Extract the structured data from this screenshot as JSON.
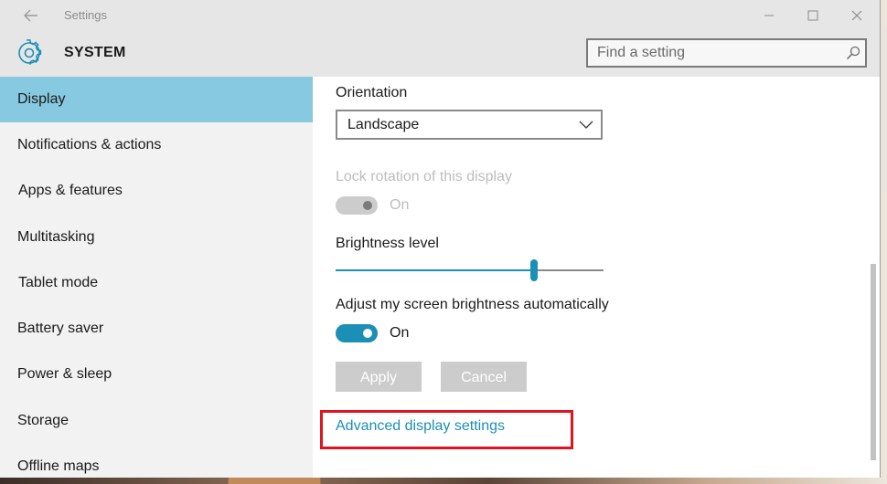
{
  "window": {
    "title": "Settings",
    "section_title": "SYSTEM"
  },
  "search": {
    "placeholder": "Find a setting"
  },
  "sidebar": {
    "items": [
      {
        "label": "Display",
        "selected": true
      },
      {
        "label": "Notifications & actions",
        "selected": false
      },
      {
        "label": "Apps & features",
        "selected": false
      },
      {
        "label": "Multitasking",
        "selected": false
      },
      {
        "label": "Tablet mode",
        "selected": false
      },
      {
        "label": "Battery saver",
        "selected": false
      },
      {
        "label": "Power & sleep",
        "selected": false
      },
      {
        "label": "Storage",
        "selected": false
      },
      {
        "label": "Offline maps",
        "selected": false
      }
    ]
  },
  "display": {
    "orientation_label": "Orientation",
    "orientation_value": "Landscape",
    "lock_rotation_label": "Lock rotation of this display",
    "lock_rotation_state": "On",
    "brightness_label": "Brightness level",
    "brightness_level": 0.74,
    "auto_brightness_label": "Adjust my screen brightness automatically",
    "auto_brightness_state": "On",
    "apply_label": "Apply",
    "cancel_label": "Cancel",
    "advanced_link": "Advanced display settings"
  },
  "icons": {
    "back": "back-arrow-icon",
    "gear": "gear-icon",
    "search": "search-icon",
    "minimize": "minimize-icon",
    "maximize": "maximize-icon",
    "close": "close-icon",
    "dropdown": "chevron-down-icon"
  },
  "colors": {
    "accent": "#1b8fb5",
    "selected_nav": "#87c9e0",
    "highlight_box": "#e0141e",
    "titlebar": "#e6e6e6",
    "sidebar": "#f2f2f2"
  }
}
